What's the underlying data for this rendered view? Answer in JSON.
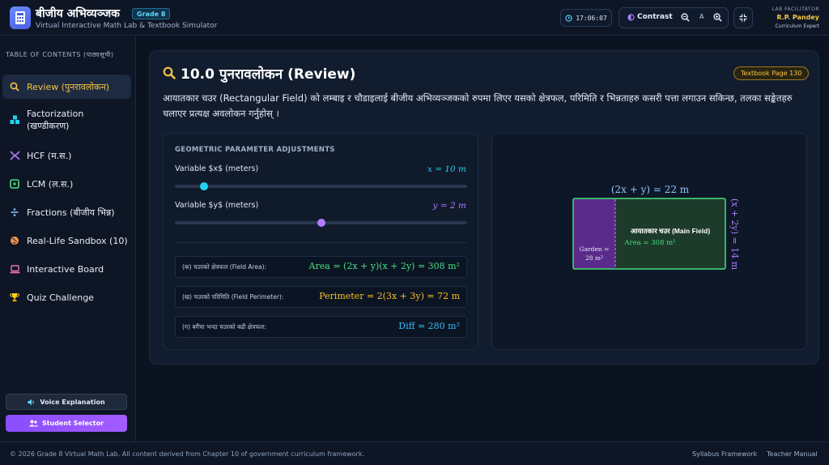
{
  "header": {
    "title": "बीजीय अभिव्यञ्जक",
    "grade": "Grade 8",
    "subtitle": "Virtual Interactive Math Lab & Textbook Simulator",
    "clock": "17:06:07",
    "contrast_label": "Contrast",
    "zoom_reset": "A",
    "facilitator_role": "LAB FACILITATOR",
    "facilitator_name": "R.P. Pandey",
    "facilitator_title": "Curriculum Expert"
  },
  "sidebar": {
    "heading": "TABLE OF CONTENTS (पाठ्यसूची)",
    "items": [
      {
        "label": "Review (पुनरावलोकन)",
        "icon": "search-icon",
        "active": true
      },
      {
        "label": "Factorization (खण्डीकरण)",
        "icon": "cubes-icon",
        "active": false
      },
      {
        "label": "HCF (म.स.)",
        "icon": "link-icon",
        "active": false
      },
      {
        "label": "LCM (ल.स.)",
        "icon": "recycle-icon",
        "active": false
      },
      {
        "label": "Fractions (बीजीय भिन्न)",
        "icon": "divide-icon",
        "active": false
      },
      {
        "label": "Real-Life Sandbox (10)",
        "icon": "globe-icon",
        "active": false
      },
      {
        "label": "Interactive Board",
        "icon": "laptop-icon",
        "active": false
      },
      {
        "label": "Quiz Challenge",
        "icon": "trophy-icon",
        "active": false
      }
    ],
    "voice_button": "Voice Explanation",
    "student_button": "Student Selector"
  },
  "main": {
    "title": "10.0 पुनरावलोकन (Review)",
    "page_badge": "Textbook Page 130",
    "description": "आयातकार चउर (Rectangular Field) को लम्बाइ र चौडाइलाई बीजीय अभिव्यञ्जकको रुपमा लिएर यसको क्षेत्रफल, परिमिति र भिन्नताहरु कसरी पत्ता लगाउन सकिन्छ, तलका सङ्केतहरु चलाएर प्रत्यक्ष अवलोकन गर्नुहोस् ।",
    "controls": {
      "heading": "GEOMETRIC PARAMETER ADJUSTMENTS",
      "x": {
        "label": "Variable $x$ (meters)",
        "value_text": "x = 10 m",
        "value": 10,
        "min": 0,
        "max": 100
      },
      "y": {
        "label": "Variable $y$ (meters)",
        "value_text": "y = 2 m",
        "value": 2,
        "min": 0,
        "max": 4
      }
    },
    "results": [
      {
        "label": "(क) चउरको क्षेत्रफल (Field Area):",
        "value": "Area = (2x + y)(x + 2y) = 308 m²"
      },
      {
        "label": "(ख) चउरको परिमिति (Field Perimeter):",
        "value": "Perimeter = 2(3x + 3y) = 72 m"
      },
      {
        "label": "(ग) बगैंचा भन्दा चउरको बढी क्षेत्रफल:",
        "value": "Diff = 280 m²"
      }
    ],
    "diagram": {
      "top_label": "(2x + y) = 22 m",
      "side_label": "(x + 2y) = 14 m",
      "main_title": "आयातकार चउर (Main Field)",
      "main_area": "Area = 308 m²",
      "garden_label": "Garden =",
      "garden_area": "28 m²"
    }
  },
  "footer": {
    "copyright": "© 2026 Grade 8 Virtual Math Lab. All content derived from Chapter 10 of government curriculum framework.",
    "link1": "Syllabus Framework",
    "link2": "Teacher Manual"
  },
  "colors": {
    "accent_gold": "#f5c542",
    "cyan": "#22d3ee",
    "purple": "#b07cff",
    "green": "#4ade80",
    "orange": "#fbbf24"
  }
}
